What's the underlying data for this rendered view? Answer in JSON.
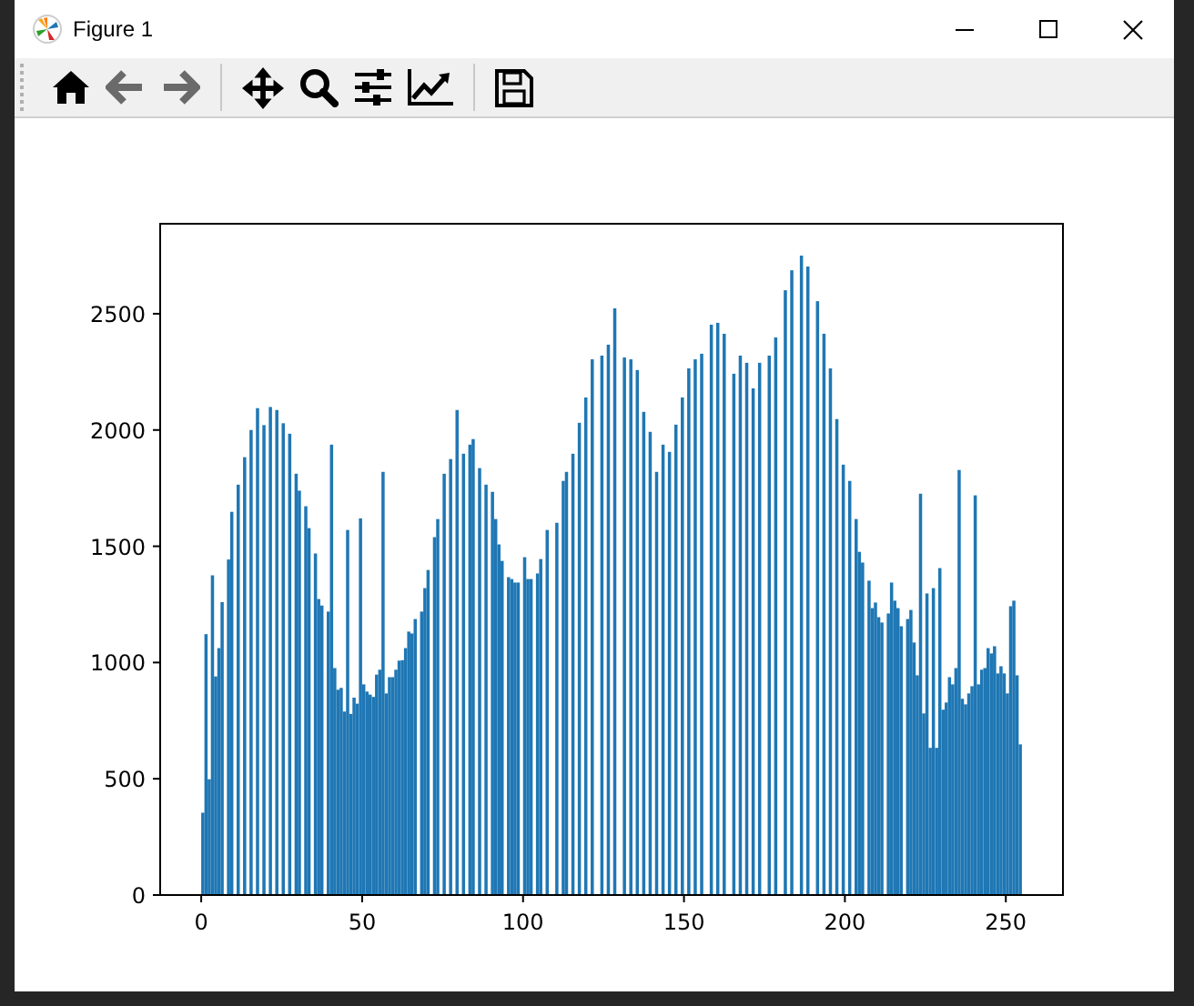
{
  "window": {
    "title": "Figure 1"
  },
  "figure": {
    "chart_data": {
      "type": "bar",
      "xlim": [
        -12.75,
        267.75
      ],
      "ylim": [
        0,
        2887
      ],
      "xticks": [
        0,
        50,
        100,
        150,
        200,
        250
      ],
      "yticks": [
        0,
        500,
        1000,
        1500,
        2000,
        2500
      ],
      "x": [
        0,
        1,
        2,
        3,
        4,
        5,
        6,
        7,
        8,
        9,
        10,
        11,
        12,
        13,
        14,
        15,
        16,
        17,
        18,
        19,
        20,
        21,
        22,
        23,
        24,
        25,
        26,
        27,
        28,
        29,
        30,
        31,
        32,
        33,
        34,
        35,
        36,
        37,
        38,
        39,
        40,
        41,
        42,
        43,
        44,
        45,
        46,
        47,
        48,
        49,
        50,
        51,
        52,
        53,
        54,
        55,
        56,
        57,
        58,
        59,
        60,
        61,
        62,
        63,
        64,
        65,
        66,
        67,
        68,
        69,
        70,
        71,
        72,
        73,
        74,
        75,
        76,
        77,
        78,
        79,
        80,
        81,
        82,
        83,
        84,
        85,
        86,
        87,
        88,
        89,
        90,
        91,
        92,
        93,
        94,
        95,
        96,
        97,
        98,
        99,
        100,
        101,
        102,
        103,
        104,
        105,
        106,
        107,
        108,
        109,
        110,
        111,
        112,
        113,
        114,
        115,
        116,
        117,
        118,
        119,
        120,
        121,
        122,
        123,
        124,
        125,
        126,
        127,
        128,
        129,
        130,
        131,
        132,
        133,
        134,
        135,
        136,
        137,
        138,
        139,
        140,
        141,
        142,
        143,
        144,
        145,
        146,
        147,
        148,
        149,
        150,
        151,
        152,
        153,
        154,
        155,
        156,
        157,
        158,
        159,
        160,
        161,
        162,
        163,
        164,
        165,
        166,
        167,
        168,
        169,
        170,
        171,
        172,
        173,
        174,
        175,
        176,
        177,
        178,
        179,
        180,
        181,
        182,
        183,
        184,
        185,
        186,
        187,
        188,
        189,
        190,
        191,
        192,
        193,
        194,
        195,
        196,
        197,
        198,
        199,
        200,
        201,
        202,
        203,
        204,
        205,
        206,
        207,
        208,
        209,
        210,
        211,
        212,
        213,
        214,
        215,
        216,
        217,
        218,
        219,
        220,
        221,
        222,
        223,
        224,
        225,
        226,
        227,
        228,
        229,
        230,
        231,
        232,
        233,
        234,
        235,
        236,
        237,
        238,
        239,
        240,
        241,
        242,
        243,
        244,
        245,
        246,
        247,
        248,
        249,
        250,
        251,
        252,
        253,
        254
      ],
      "series": [
        {
          "color": "#1f77b4",
          "values": [
            354,
            1122,
            498,
            1375,
            940,
            1062,
            1260,
            0,
            1443,
            1648,
            0,
            1765,
            0,
            1883,
            0,
            2000,
            0,
            2094,
            0,
            2021,
            0,
            2099,
            0,
            2086,
            0,
            2029,
            0,
            1984,
            0,
            1812,
            1739,
            0,
            1672,
            1578,
            0,
            1469,
            1273,
            1245,
            0,
            1219,
            1937,
            976,
            883,
            891,
            789,
            1570,
            779,
            849,
            823,
            1620,
            906,
            875,
            862,
            852,
            948,
            969,
            1820,
            867,
            937,
            937,
            969,
            1008,
            1010,
            1062,
            1133,
            1125,
            1187,
            0,
            1219,
            1320,
            1398,
            0,
            1539,
            1617,
            0,
            1812,
            0,
            1875,
            0,
            2086,
            0,
            1898,
            0,
            1937,
            1961,
            0,
            1836,
            0,
            1765,
            0,
            1734,
            1617,
            1508,
            1437,
            0,
            1367,
            1359,
            1344,
            1344,
            0,
            1453,
            1359,
            1359,
            0,
            1383,
            1445,
            0,
            1570,
            0,
            0,
            1601,
            0,
            1781,
            1820,
            0,
            1898,
            0,
            2031,
            0,
            2140,
            0,
            2304,
            0,
            0,
            2320,
            0,
            2367,
            0,
            2523,
            0,
            0,
            2312,
            0,
            2304,
            0,
            2258,
            0,
            2078,
            0,
            1992,
            0,
            1820,
            0,
            1937,
            0,
            1906,
            0,
            2023,
            0,
            2140,
            0,
            2265,
            0,
            2304,
            0,
            2328,
            0,
            0,
            2453,
            0,
            2461,
            0,
            2414,
            0,
            0,
            2242,
            0,
            2320,
            0,
            2289,
            0,
            2179,
            0,
            2289,
            0,
            0,
            2320,
            0,
            2398,
            0,
            0,
            2601,
            0,
            2687,
            0,
            0,
            2750,
            0,
            2703,
            0,
            0,
            2554,
            0,
            2414,
            0,
            2265,
            0,
            2047,
            0,
            1851,
            0,
            1781,
            0,
            1617,
            1476,
            1430,
            0,
            1352,
            1234,
            1258,
            1195,
            1172,
            0,
            1211,
            1344,
            1266,
            1234,
            1156,
            0,
            1187,
            1226,
            1086,
            945,
            1726,
            781,
            1297,
            633,
            1320,
            633,
            1406,
            797,
            828,
            937,
            906,
            976,
            1828,
            844,
            820,
            867,
            898,
            1719,
            906,
            969,
            976,
            1062,
            1039,
            1070,
            953,
            984,
            953,
            867,
            1242,
            1266,
            945,
            648
          ]
        }
      ]
    }
  }
}
